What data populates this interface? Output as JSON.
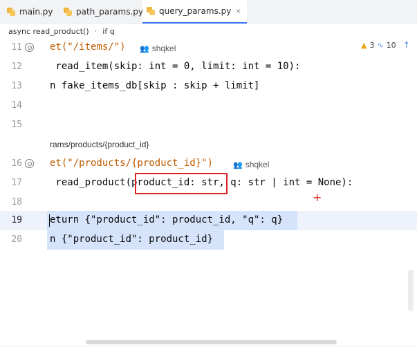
{
  "tabs": [
    {
      "label": "main.py",
      "active": false
    },
    {
      "label": "path_params.py",
      "active": false
    },
    {
      "label": "query_params.py",
      "active": true,
      "close": "×"
    }
  ],
  "breadcrumb": [
    "async read_product()",
    "if q"
  ],
  "inspections": {
    "warnings": "3",
    "typos": "10"
  },
  "lines": [
    {
      "num": "11",
      "code": "et(\"/items/\")",
      "author": "shqkel"
    },
    {
      "num": "12",
      "code": " read_item(skip: int = 0, limit: int = 10):"
    },
    {
      "num": "13",
      "code": "n fake_items_db[skip : skip + limit]"
    },
    {
      "num": "14",
      "code": ""
    },
    {
      "num": "15",
      "code": ""
    },
    {
      "num": "",
      "code": "rams/products/{product_id}"
    },
    {
      "num": "16",
      "code": "et(\"/products/{product_id}\")",
      "author": "shqkel"
    },
    {
      "num": "17",
      "code": " read_product(product_id: str, q: str | int = None):"
    },
    {
      "num": "18",
      "code": ""
    },
    {
      "num": "19",
      "code": "eturn {\"product_id\": product_id, \"q\": q}"
    },
    {
      "num": "20",
      "code": "n {\"product_id\": product_id}"
    }
  ]
}
